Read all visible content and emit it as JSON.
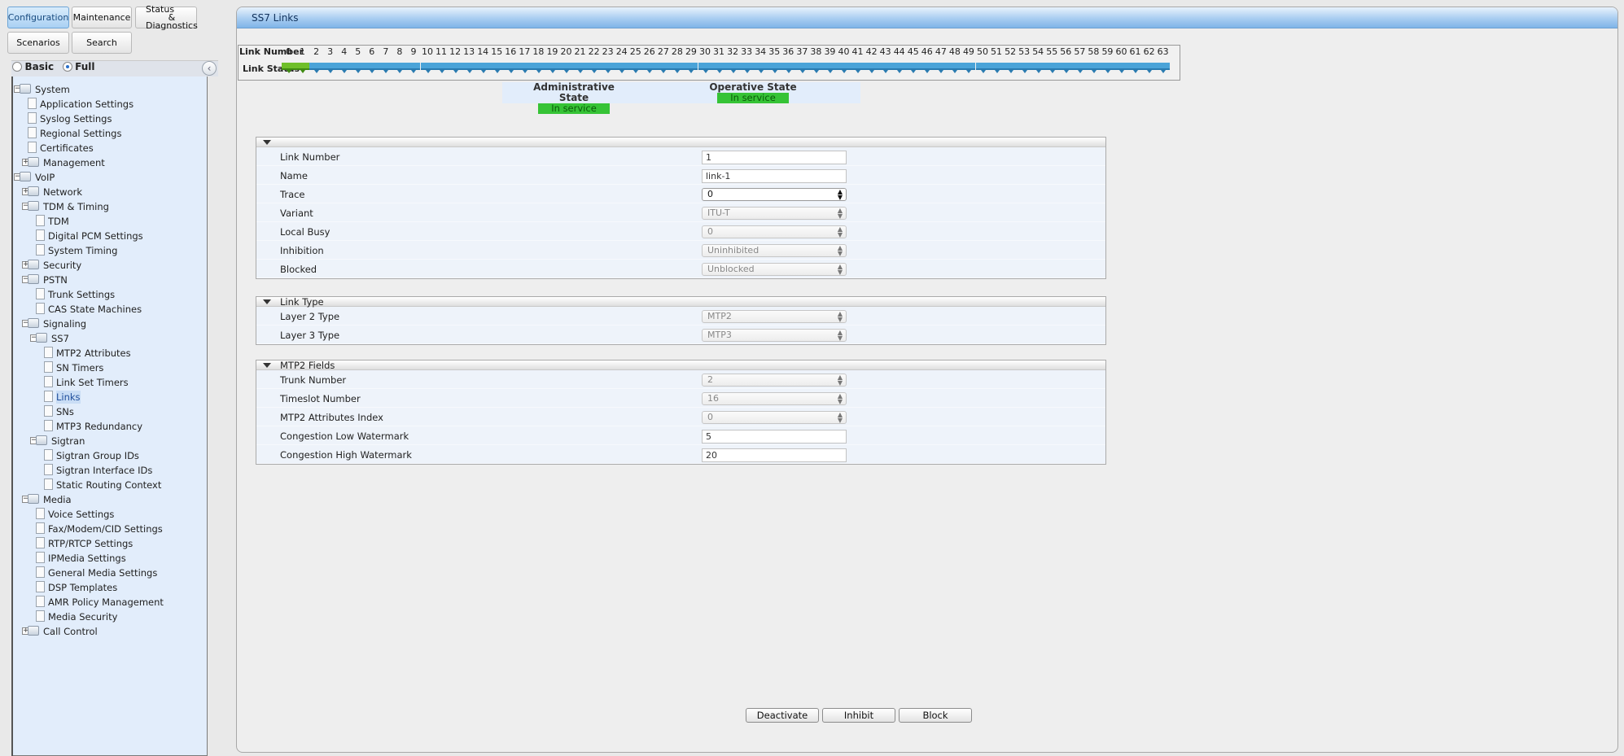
{
  "nav": {
    "configuration": "Configuration",
    "maintenance": "Maintenance",
    "status_line1": "Status",
    "status_line2": "& Diagnostics",
    "scenarios": "Scenarios",
    "search": "Search"
  },
  "mode": {
    "basic": "Basic",
    "full": "Full",
    "selected": "Full"
  },
  "tree": [
    {
      "label": "System",
      "type": "folder",
      "expand": "-",
      "level": 0
    },
    {
      "label": "Application Settings",
      "type": "page",
      "level": 1
    },
    {
      "label": "Syslog Settings",
      "type": "page",
      "level": 1
    },
    {
      "label": "Regional Settings",
      "type": "page",
      "level": 1
    },
    {
      "label": "Certificates",
      "type": "page",
      "level": 1
    },
    {
      "label": "Management",
      "type": "folder",
      "expand": "+",
      "level": 1
    },
    {
      "label": "VoIP",
      "type": "folder",
      "expand": "-",
      "level": 0
    },
    {
      "label": "Network",
      "type": "folder",
      "expand": "+",
      "level": 1
    },
    {
      "label": "TDM & Timing",
      "type": "folder",
      "expand": "-",
      "level": 1
    },
    {
      "label": "TDM",
      "type": "page",
      "level": 2
    },
    {
      "label": "Digital PCM Settings",
      "type": "page",
      "level": 2
    },
    {
      "label": "System Timing",
      "type": "page",
      "level": 2
    },
    {
      "label": "Security",
      "type": "folder",
      "expand": "+",
      "level": 1
    },
    {
      "label": "PSTN",
      "type": "folder",
      "expand": "-",
      "level": 1
    },
    {
      "label": "Trunk Settings",
      "type": "page",
      "level": 2
    },
    {
      "label": "CAS State Machines",
      "type": "page",
      "level": 2
    },
    {
      "label": "Signaling",
      "type": "folder",
      "expand": "-",
      "level": 1
    },
    {
      "label": "SS7",
      "type": "folder",
      "expand": "-",
      "level": 2
    },
    {
      "label": "MTP2 Attributes",
      "type": "page",
      "level": 3
    },
    {
      "label": "SN Timers",
      "type": "page",
      "level": 3
    },
    {
      "label": "Link Set Timers",
      "type": "page",
      "level": 3
    },
    {
      "label": "Links",
      "type": "page",
      "level": 3,
      "selected": true
    },
    {
      "label": "SNs",
      "type": "page",
      "level": 3
    },
    {
      "label": "MTP3 Redundancy",
      "type": "page",
      "level": 3
    },
    {
      "label": "Sigtran",
      "type": "folder",
      "expand": "-",
      "level": 2
    },
    {
      "label": "Sigtran Group IDs",
      "type": "page",
      "level": 3
    },
    {
      "label": "Sigtran Interface IDs",
      "type": "page",
      "level": 3
    },
    {
      "label": "Static Routing Context",
      "type": "page",
      "level": 3
    },
    {
      "label": "Media",
      "type": "folder",
      "expand": "-",
      "level": 1
    },
    {
      "label": "Voice Settings",
      "type": "page",
      "level": 2
    },
    {
      "label": "Fax/Modem/CID Settings",
      "type": "page",
      "level": 2
    },
    {
      "label": "RTP/RTCP Settings",
      "type": "page",
      "level": 2
    },
    {
      "label": "IPMedia Settings",
      "type": "page",
      "level": 2
    },
    {
      "label": "General Media Settings",
      "type": "page",
      "level": 2
    },
    {
      "label": "DSP Templates",
      "type": "page",
      "level": 2
    },
    {
      "label": "AMR Policy Management",
      "type": "page",
      "level": 2
    },
    {
      "label": "Media Security",
      "type": "page",
      "level": 2
    },
    {
      "label": "Call Control",
      "type": "folder",
      "expand": "+",
      "level": 1
    }
  ],
  "page": {
    "title": "SS7 Links"
  },
  "link_grid": {
    "number_label": "Link Number",
    "status_label": "Link Status",
    "numbers": [
      "0",
      "1",
      "2",
      "3",
      "4",
      "5",
      "6",
      "7",
      "8",
      "9",
      "10",
      "11",
      "12",
      "13",
      "14",
      "15",
      "16",
      "17",
      "18",
      "19",
      "20",
      "21",
      "22",
      "23",
      "24",
      "25",
      "26",
      "27",
      "28",
      "29",
      "30",
      "31",
      "32",
      "33",
      "34",
      "35",
      "36",
      "37",
      "38",
      "39",
      "40",
      "41",
      "42",
      "43",
      "44",
      "45",
      "46",
      "47",
      "48",
      "49",
      "50",
      "51",
      "52",
      "53",
      "54",
      "55",
      "56",
      "57",
      "58",
      "59",
      "60",
      "61",
      "62",
      "63"
    ],
    "active_links": [
      0,
      1
    ],
    "colors": {
      "active": "#6fbf2a",
      "inactive": "#4aa3d8"
    }
  },
  "states": {
    "admin_label": "Administrative State",
    "admin_value": "In service",
    "oper_label": "Operative State",
    "oper_value": "In service",
    "color": "#36c336"
  },
  "sections": [
    {
      "title": "",
      "fields": [
        {
          "label": "Link Number",
          "kind": "input",
          "value": "1"
        },
        {
          "label": "Name",
          "kind": "input",
          "value": "link-1"
        },
        {
          "label": "Trace",
          "kind": "select",
          "value": "0",
          "enabled": true
        },
        {
          "label": "Variant",
          "kind": "select",
          "value": "ITU-T",
          "enabled": false
        },
        {
          "label": "Local Busy",
          "kind": "select",
          "value": "0",
          "enabled": false
        },
        {
          "label": "Inhibition",
          "kind": "select",
          "value": "Uninhibited",
          "enabled": false
        },
        {
          "label": "Blocked",
          "kind": "select",
          "value": "Unblocked",
          "enabled": false
        }
      ]
    },
    {
      "title": "Link Type",
      "fields": [
        {
          "label": "Layer 2 Type",
          "kind": "select",
          "value": "MTP2",
          "enabled": false
        },
        {
          "label": "Layer 3 Type",
          "kind": "select",
          "value": "MTP3",
          "enabled": false
        }
      ]
    },
    {
      "title": "MTP2 Fields",
      "fields": [
        {
          "label": "Trunk Number",
          "kind": "select",
          "value": "2",
          "enabled": false
        },
        {
          "label": "Timeslot Number",
          "kind": "select",
          "value": "16",
          "enabled": false
        },
        {
          "label": "MTP2 Attributes Index",
          "kind": "select",
          "value": "0",
          "enabled": false
        },
        {
          "label": "Congestion Low Watermark",
          "kind": "input",
          "value": "5"
        },
        {
          "label": "Congestion High Watermark",
          "kind": "input",
          "value": "20"
        }
      ]
    }
  ],
  "actions": {
    "deactivate": "Deactivate",
    "inhibit": "Inhibit",
    "block": "Block"
  }
}
